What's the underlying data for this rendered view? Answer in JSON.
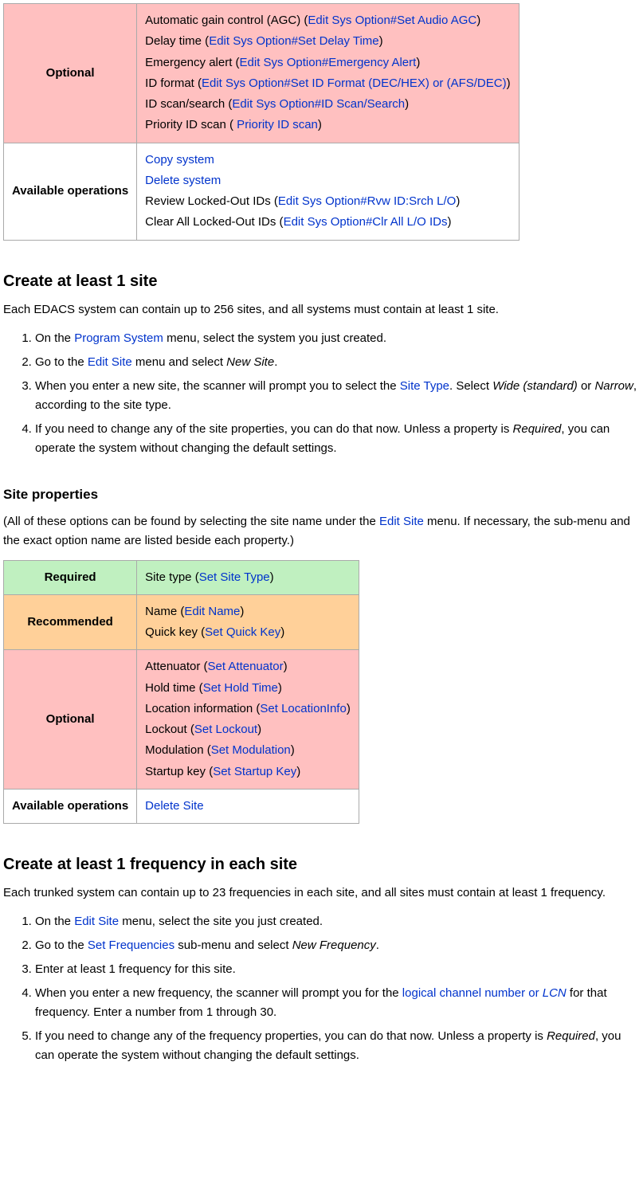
{
  "t1": {
    "optional_label": "Optional",
    "agc_text": "Automatic gain control (AGC) (",
    "agc_link": "Edit Sys Option#Set Audio AGC",
    "delay_text": "Delay time (",
    "delay_link": "Edit Sys Option#Set Delay Time",
    "emergency_text": "Emergency alert (",
    "emergency_link": "Edit Sys Option#Emergency Alert",
    "idformat_text": "ID format (",
    "idformat_link": "Edit Sys Option#Set ID Format (DEC/HEX) or (AFS/DEC)",
    "idscan_text": "ID scan/search (",
    "idscan_link": "Edit Sys Option#ID Scan/Search",
    "priority_text": "Priority ID scan (",
    "priority_link": " Priority ID scan",
    "available_label": "Available operations",
    "copy_link": "Copy system",
    "delete_link": "Delete system",
    "review_text": "Review Locked-Out IDs (",
    "review_link": "Edit Sys Option#Rvw ID:Srch L/O",
    "clear_text": "Clear All Locked-Out IDs (",
    "clear_link": "Edit Sys Option#Clr All L/O IDs"
  },
  "section1": {
    "heading": "Create at least 1 site",
    "intro": "Each EDACS system can contain up to 256 sites, and all systems must contain at least 1 site.",
    "step1_a": "On the ",
    "step1_link": "Program System",
    "step1_b": " menu, select the system you just created.",
    "step2_a": "Go to the ",
    "step2_link": "Edit Site",
    "step2_b": " menu and select ",
    "step2_em": "New Site",
    "step2_c": ".",
    "step3_a": "When you enter a new site, the scanner will prompt you to select the ",
    "step3_link": "Site Type",
    "step3_b": ". Select ",
    "step3_em1": "Wide (standard)",
    "step3_c": " or ",
    "step3_em2": "Narrow",
    "step3_d": ", according to the site type.",
    "step4_a": "If you need to change any of the site properties, you can do that now. Unless a property is ",
    "step4_em": "Required",
    "step4_b": ", you can operate the system without changing the default settings."
  },
  "section2": {
    "heading": "Site properties",
    "intro_a": "(All of these options can be found by selecting the site name under the ",
    "intro_link": "Edit Site",
    "intro_b": " menu. If necessary, the sub-menu and the exact option name are listed beside each property.)"
  },
  "t2": {
    "required_label": "Required",
    "sitetype_text": "Site type (",
    "sitetype_link": "Set Site Type",
    "recommended_label": "Recommended",
    "name_text": "Name (",
    "name_link": "Edit Name",
    "quickkey_text": "Quick key (",
    "quickkey_link": "Set Quick Key",
    "optional_label": "Optional",
    "atten_text": "Attenuator (",
    "atten_link": "Set Attenuator",
    "hold_text": "Hold time (",
    "hold_link": "Set Hold Time",
    "loc_text": "Location information (",
    "loc_link": "Set LocationInfo",
    "lockout_text": "Lockout (",
    "lockout_link": "Set Lockout",
    "mod_text": "Modulation (",
    "mod_link": "Set Modulation",
    "startup_text": "Startup key (",
    "startup_link": "Set Startup Key",
    "available_label": "Available operations",
    "deletesite_link": "Delete Site"
  },
  "section3": {
    "heading": "Create at least 1 frequency in each site",
    "intro": "Each trunked system can contain up to 23 frequencies in each site, and all sites must contain at least 1 frequency.",
    "step1_a": "On the ",
    "step1_link": "Edit Site",
    "step1_b": " menu, select the site you just created.",
    "step2_a": "Go to the ",
    "step2_link": "Set Frequencies",
    "step2_b": " sub-menu and select ",
    "step2_em": "New Frequency",
    "step2_c": ".",
    "step3": "Enter at least 1 frequency for this site.",
    "step4_a": "When you enter a new frequency, the scanner will prompt you for the ",
    "step4_link": "logical channel number or ",
    "step4_link_em": "LCN",
    "step4_b": " for that frequency. Enter a number from 1 through 30.",
    "step5_a": "If you need to change any of the frequency properties, you can do that now. Unless a property is ",
    "step5_em": "Required",
    "step5_b": ", you can operate the system without changing the default settings."
  },
  "close_paren": ")"
}
